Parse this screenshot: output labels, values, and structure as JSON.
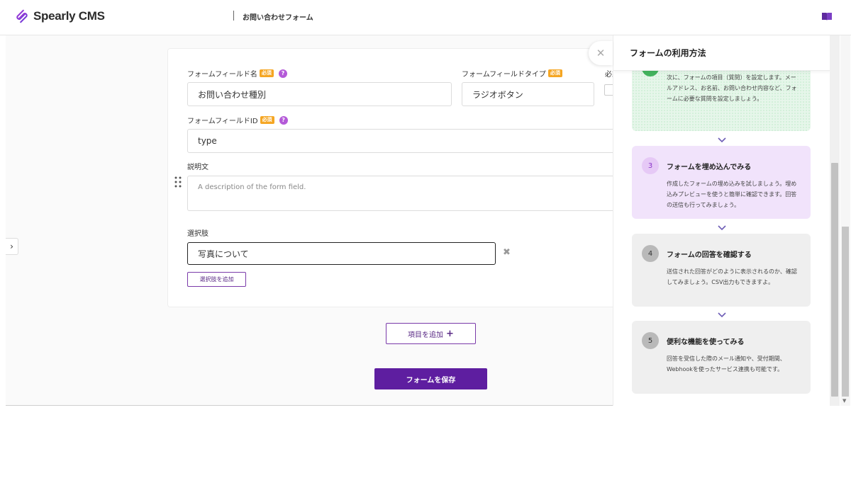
{
  "header": {
    "logo_text": "Spearly CMS",
    "page_title": "お問い合わせフォーム"
  },
  "form": {
    "field_name_label": "フォームフィールド名",
    "required_badge": "必須",
    "field_name_value": "お問い合わせ種別",
    "field_type_label": "フォームフィールドタイプ",
    "field_type_value": "ラジオボタン",
    "required_col_label": "必須",
    "field_id_label": "フォームフィールドID",
    "field_id_value": "type",
    "description_label": "説明文",
    "description_placeholder": "A description of the form field.",
    "choices_label": "選択肢",
    "choice_value": "写真について",
    "add_choice_button": "選択肢を追加",
    "help_glyph": "?"
  },
  "actions": {
    "add_item_button": "項目を追加",
    "add_item_plus": "+",
    "save_button": "フォームを保存"
  },
  "guide": {
    "title": "フォームの利用方法",
    "steps": [
      {
        "num": "",
        "title": "",
        "desc": "次に、フォームの項目（質問）を設定します。メールアドレス、お名前、お問い合わせ内容など、フォームに必要な質問を設定しましょう。"
      },
      {
        "num": "3",
        "title": "フォームを埋め込んでみる",
        "desc": "作成したフォームの埋め込みを試しましょう。埋め込みプレビューを使うと簡単に確認できます。回答の送信も行ってみましょう。"
      },
      {
        "num": "4",
        "title": "フォームの回答を確認する",
        "desc": "送信された回答がどのように表示されるのか、確認してみましょう。CSV出力もできますよ。"
      },
      {
        "num": "5",
        "title": "便利な機能を使ってみる",
        "desc": "回答を受信した際のメール通知や、受付期間、Webhookを使ったサービス連携も可能です。"
      }
    ]
  },
  "colors": {
    "brand_purple": "#5e1ea0",
    "required_orange": "#f5a623",
    "step_green": "#e6f6ea",
    "step_purple": "#f1e3fb",
    "step_gray": "#efefef"
  },
  "icons": {
    "logo": "spearly-logo-icon",
    "book": "book-icon",
    "help": "help-icon",
    "drag": "drag-handle-icon",
    "close": "close-icon",
    "chevron": "chevron-down-icon",
    "expand": "chevron-right-icon"
  }
}
